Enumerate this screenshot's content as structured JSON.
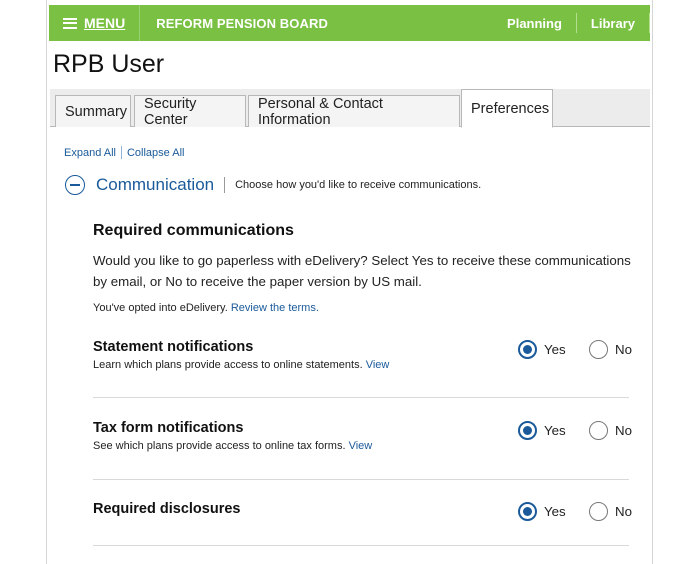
{
  "header": {
    "menu_label": "MENU",
    "brand": "REFORM PENSION BOARD",
    "nav": [
      "Planning",
      "Library"
    ],
    "bg_color": "#7ac143"
  },
  "page_title": "RPB User",
  "tabs": [
    {
      "label": "Summary",
      "active": false
    },
    {
      "label": "Security Center",
      "active": false
    },
    {
      "label": "Personal & Contact Information",
      "active": false
    },
    {
      "label": "Preferences",
      "active": true
    }
  ],
  "links": {
    "expand": "Expand All",
    "collapse": "Collapse All"
  },
  "section": {
    "title": "Communication",
    "description": "Choose how you'd like to receive communications."
  },
  "required": {
    "title": "Required communications",
    "body": "Would you like to go paperless with eDelivery? Select Yes to receive these communications by email, or No to receive the paper version by US mail.",
    "opted_text": "You've opted into eDelivery. ",
    "terms_link": "Review the terms."
  },
  "preferences": [
    {
      "title": "Statement notifications",
      "desc": "Learn which plans provide access to online statements. ",
      "link": "View",
      "selected": "Yes"
    },
    {
      "title": "Tax form notifications",
      "desc": "See which plans provide access to online tax forms. ",
      "link": "View",
      "selected": "Yes"
    },
    {
      "title": "Required disclosures",
      "desc": "",
      "link": "",
      "selected": "Yes"
    }
  ],
  "options": {
    "yes": "Yes",
    "no": "No"
  },
  "accent_color": "#1a5a9a"
}
